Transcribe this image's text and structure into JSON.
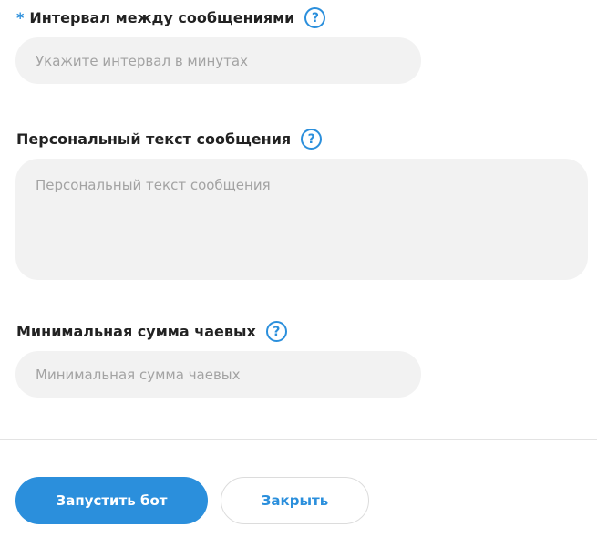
{
  "fields": {
    "interval": {
      "required_mark": "*",
      "label": "Интервал между сообщениями",
      "placeholder": "Укажите интервал в минутах",
      "value": ""
    },
    "personal_text": {
      "label": "Персональный текст сообщения",
      "placeholder": "Персональный текст сообщения",
      "value": ""
    },
    "min_tip": {
      "label": "Минимальная сумма чаевых",
      "placeholder": "Минимальная сумма чаевых",
      "value": ""
    },
    "help_icon_glyph": "?"
  },
  "buttons": {
    "start": "Запустить бот",
    "close": "Закрыть"
  },
  "colors": {
    "accent": "#2b8fdc",
    "input_bg": "#f2f2f2",
    "label_text": "#222222",
    "placeholder_text": "#a3a3a3",
    "divider": "#e3e3e3"
  },
  "icons": {
    "help": "question-circle-icon"
  }
}
